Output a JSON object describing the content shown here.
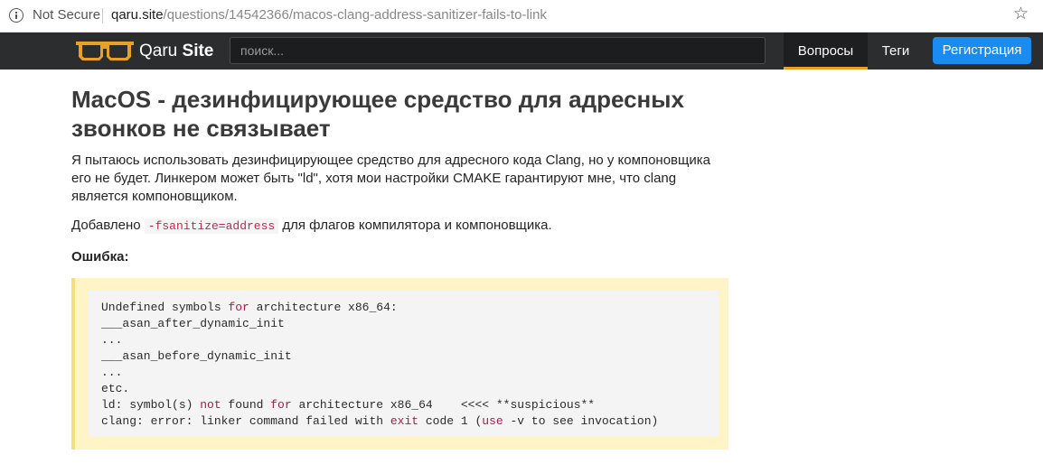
{
  "browser": {
    "security_label": "Not Secure",
    "url_host": "qaru.site",
    "url_path": "/questions/14542366/macos-clang-address-sanitizer-fails-to-link",
    "info_icon": "info-circle-icon",
    "bookmark_icon": "star-icon"
  },
  "navbar": {
    "logo_icon": "glasses-icon",
    "brand_part1": "Qaru ",
    "brand_part2": "Site",
    "search_placeholder": "поиск...",
    "nav_questions": "Вопросы",
    "nav_tags": "Теги",
    "register_label": "Регистрация"
  },
  "question": {
    "title": "MacOS - дезинфицирующее средство для адресных звонков не связывает",
    "paragraph1": "Я пытаюсь использовать дезинфицирующее средство для адресного кода Clang, но у компоновщика его не будет. Линкером может быть \"ld\", хотя мои настройки CMAKE гарантируют мне, что clang является компоновщиком.",
    "p2_before": "Добавлено ",
    "p2_code": "-fsanitize=address",
    "p2_after": " для флагов компилятора и компоновщика.",
    "error_label": "Ошибка:"
  },
  "code": {
    "l1a": "Undefined symbols ",
    "l1b": "for",
    "l1c": " architecture x86_64:",
    "l2": "___asan_after_dynamic_init",
    "l3": "...",
    "l4": "___asan_before_dynamic_init",
    "l5": "...",
    "l6": "etc.",
    "l7a": "ld: symbol(s) ",
    "l7b": "not",
    "l7c": " found ",
    "l7d": "for",
    "l7e": " architecture x86_64    <<<< **suspicious**",
    "l8a": "clang: error: linker command failed with ",
    "l8b": "exit",
    "l8c": " code 1 (",
    "l8d": "use",
    "l8e": " -v to see invocation)"
  },
  "colors": {
    "navbar_bg": "#2b2d2e",
    "accent_orange": "#e7a226",
    "register_blue": "#1a8cf0",
    "quote_bg": "#fff4c5",
    "keyword": "#b0164a"
  }
}
